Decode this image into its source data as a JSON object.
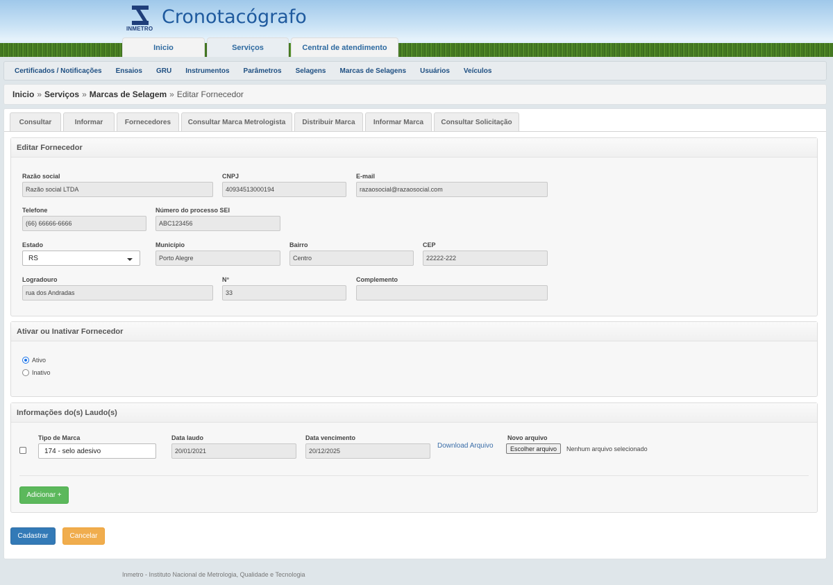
{
  "header": {
    "logo_text": "INMETRO",
    "app_title": "Cronotacógrafo",
    "tabs": [
      "Inicio",
      "Serviços",
      "Central de atendimento"
    ]
  },
  "navbar": {
    "items": [
      "Certificados / Notificações",
      "Ensaios",
      "GRU",
      "Instrumentos",
      "Parâmetros",
      "Selagens",
      "Marcas de Selagens",
      "Usuários",
      "Veículos"
    ]
  },
  "breadcrumb": {
    "items": [
      "Inicio",
      "Serviços",
      "Marcas de Selagem"
    ],
    "separator": "»",
    "current": "Editar Fornecedor"
  },
  "sub_tabs": [
    "Consultar",
    "Informar",
    "Fornecedores",
    "Consultar Marca Metrologista",
    "Distribuir Marca",
    "Informar Marca",
    "Consultar Solicitação"
  ],
  "editar": {
    "title": "Editar Fornecedor",
    "razao_label": "Razão social",
    "razao_value": "Razão social  LTDA",
    "cnpj_label": "CNPJ",
    "cnpj_value": "40934513000194",
    "email_label": "E-mail",
    "email_value": "razaosocial@razaosocial.com",
    "telefone_label": "Telefone",
    "telefone_value": "(66) 66666-6666",
    "processo_label": "Número do processo SEI",
    "processo_value": "ABC123456",
    "estado_label": "Estado",
    "estado_value": "RS",
    "municipio_label": "Município",
    "municipio_value": "Porto Alegre",
    "bairro_label": "Bairro",
    "bairro_value": "Centro",
    "cep_label": "CEP",
    "cep_value": "22222-222",
    "logradouro_label": "Logradouro",
    "logradouro_value": "rua dos Andradas",
    "numero_label": "N°",
    "numero_value": "33",
    "complemento_label": "Complemento",
    "complemento_value": ""
  },
  "ativar": {
    "title": "Ativar ou Inativar Fornecedor",
    "ativo_label": "Ativo",
    "inativo_label": "Inativo",
    "selected": "Ativo"
  },
  "laudos": {
    "title": "Informações do(s) Laudo(s)",
    "tipo_label": "Tipo de Marca",
    "tipo_value": "174 - selo adesivo",
    "data_laudo_label": "Data laudo",
    "data_laudo_value": "20/01/2021",
    "data_venc_label": "Data vencimento",
    "data_venc_value": "20/12/2025",
    "download_label": "Download Arquivo",
    "novo_label": "Novo arquivo",
    "file_button": "Escolher arquivo",
    "file_status": "Nenhum arquivo selecionado",
    "add_button": "Adicionar +"
  },
  "actions": {
    "submit": "Cadastrar",
    "cancel": "Cancelar"
  },
  "footer": {
    "text": "Inmetro - Instituto Nacional de Metrologia, Qualidade e Tecnologia"
  },
  "colors": {
    "primary": "#337ab7",
    "success": "#5cb85c",
    "warning": "#f0ad4e",
    "title": "#1f5a9e"
  }
}
